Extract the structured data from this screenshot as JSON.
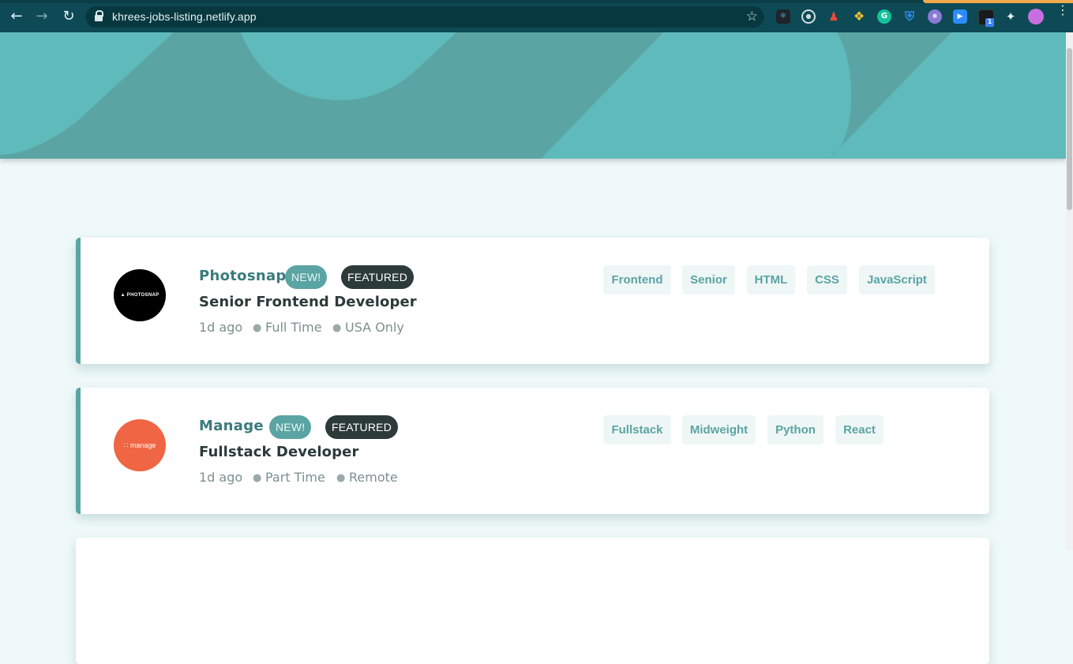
{
  "browser": {
    "url": "khrees-jobs-listing.netlify.app",
    "extension_icons": [
      "react-devtools-icon",
      "circle-target-icon",
      "person-icon",
      "color-picker-icon",
      "grammarly-icon",
      "shield-icon",
      "brain-icon",
      "zoom-icon",
      "box-badge-icon",
      "puzzle-icon",
      "profile-avatar"
    ],
    "extension_badge": "1"
  },
  "colors": {
    "banner": "#5fbabb",
    "primary": "#5ba4a4",
    "dark": "#2c3a3a",
    "background": "#eff9f9"
  },
  "jobs": [
    {
      "company": "Photosnap",
      "logo_text": "▲ PHOTOSNAP",
      "new_badge": "NEW!",
      "featured_badge": "FEATURED",
      "position": "Senior Frontend Developer",
      "posted": "1d ago",
      "contract": "Full Time",
      "location": "USA Only",
      "tags": [
        "Frontend",
        "Senior",
        "HTML",
        "CSS",
        "JavaScript"
      ]
    },
    {
      "company": "Manage",
      "logo_text": "∷ manage",
      "new_badge": "NEW!",
      "featured_badge": "FEATURED",
      "position": "Fullstack Developer",
      "posted": "1d ago",
      "contract": "Part Time",
      "location": "Remote",
      "tags": [
        "Fullstack",
        "Midweight",
        "Python",
        "React"
      ]
    }
  ]
}
